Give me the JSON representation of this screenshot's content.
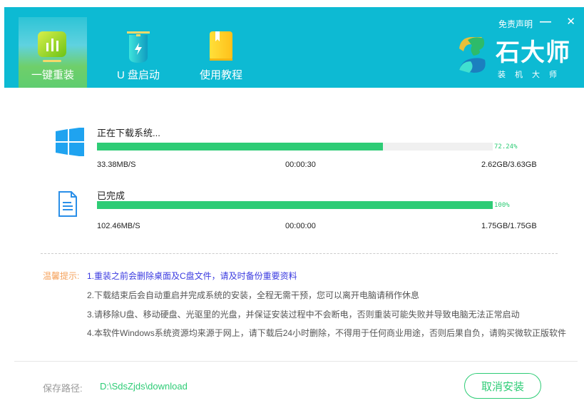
{
  "header": {
    "tabs": [
      {
        "label": "一键重装",
        "active": true
      },
      {
        "label": "U 盘启动"
      },
      {
        "label": "使用教程"
      }
    ],
    "disclaimer": "免责声明",
    "minimize": "—",
    "close": "✕",
    "brand": "石大师",
    "brand_sub": "装机大师"
  },
  "downloads": [
    {
      "title": "正在下载系统...",
      "percent": 72.24,
      "percent_label": "72.24%",
      "speed": "33.38MB/S",
      "time": "00:00:30",
      "size": "2.62GB/3.63GB",
      "icon": "windows-icon"
    },
    {
      "title": "已完成",
      "percent": 100,
      "percent_label": "100%",
      "speed": "102.46MB/S",
      "time": "00:00:00",
      "size": "1.75GB/1.75GB",
      "icon": "document-icon"
    }
  ],
  "tips": {
    "label": "温馨提示:",
    "items": [
      "1.重装之前会删除桌面及C盘文件，请及时备份重要资料",
      "2.下载结束后会自动重启并完成系统的安装，全程无需干预，您可以离开电脑请稍作休息",
      "3.请移除U盘、移动硬盘、光驱里的光盘，并保证安装过程中不会断电，否则重装可能失败并导致电脑无法正常启动",
      "4.本软件Windows系统资源均来源于网上，请下载后24小时删除，不得用于任何商业用途，否则后果自负，请购买微软正版软件"
    ]
  },
  "footer": {
    "path_label": "保存路径:",
    "path_value": "D:\\SdsZjds\\download",
    "cancel_label": "取消安装"
  },
  "colors": {
    "header": "#0dbad3",
    "accent": "#2ecc76",
    "tip_label": "#f5a15a",
    "tip_first": "#3a3ae0"
  }
}
